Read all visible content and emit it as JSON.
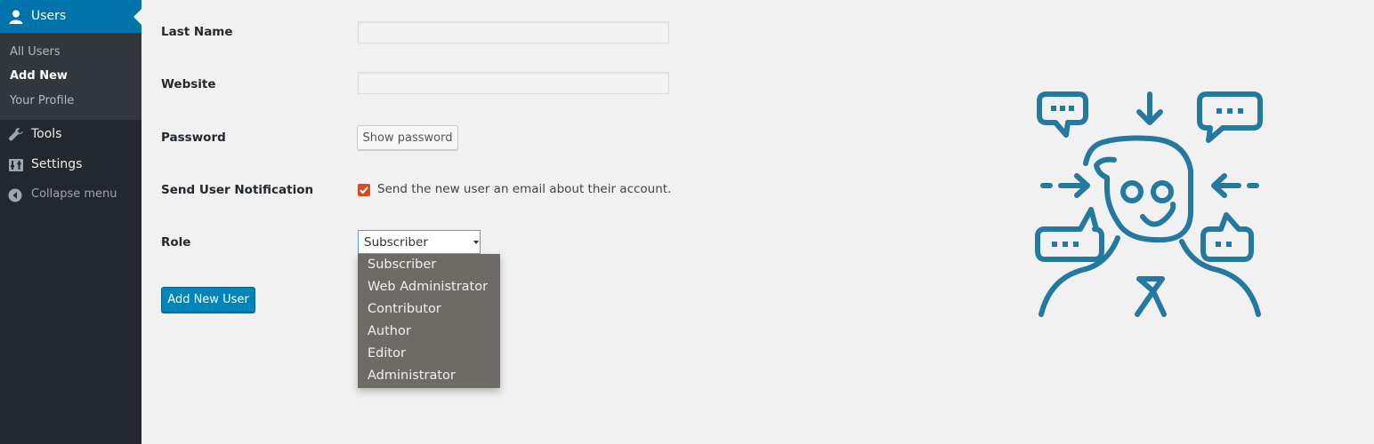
{
  "sidebar": {
    "users_label": "Users",
    "submenu": [
      "All Users",
      "Add New",
      "Your Profile"
    ],
    "tools_label": "Tools",
    "settings_label": "Settings",
    "collapse_label": "Collapse menu"
  },
  "form": {
    "last_name_label": "Last Name",
    "last_name_value": "",
    "website_label": "Website",
    "website_value": "",
    "password_label": "Password",
    "show_password_label": "Show password",
    "notification_label": "Send User Notification",
    "notification_checked": true,
    "notification_text": "Send the new user an email about their account.",
    "role_label": "Role",
    "role_selected": "Subscriber",
    "role_options": [
      "Subscriber",
      "Web Administrator",
      "Contributor",
      "Author",
      "Editor",
      "Administrator"
    ],
    "submit_label": "Add New User"
  },
  "colors": {
    "sidebar_bg": "#23282d",
    "active_menu": "#0073aa",
    "primary_button": "#0085ba",
    "checkbox": "#d54e21",
    "dropdown_bg": "#6e6b66",
    "illustration_stroke": "#2479a0"
  },
  "icons": {
    "users": "user-icon",
    "tools": "wrench-icon",
    "settings": "settings-icon",
    "collapse": "collapse-arrow-icon",
    "illustration": "person-with-chat-bubbles-icon"
  }
}
